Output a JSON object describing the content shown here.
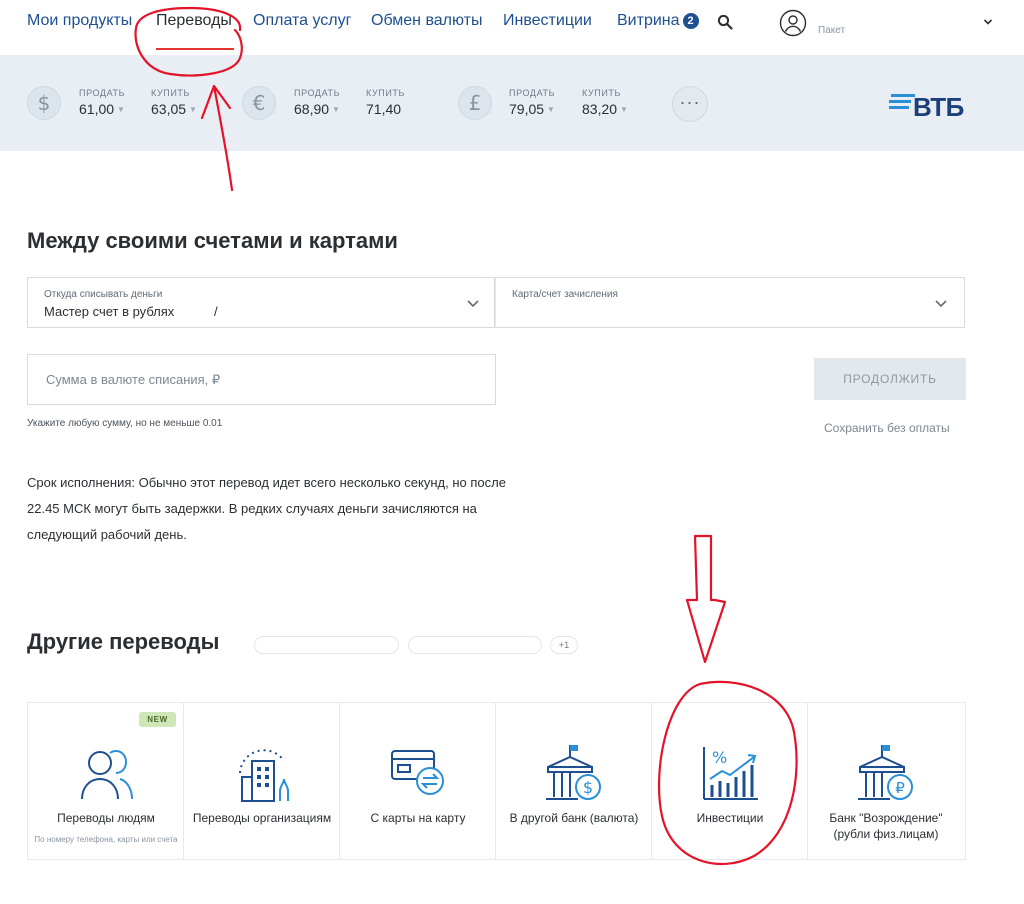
{
  "nav": {
    "items": [
      "Мои продукты",
      "Переводы",
      "Оплата услуг",
      "Обмен валюты",
      "Инвестиции",
      "Витрина"
    ],
    "showcase_badge": "2",
    "account_label": "Пакет"
  },
  "rates": {
    "sell_label": "ПРОДАТЬ",
    "buy_label": "КУПИТЬ",
    "currencies": [
      {
        "symbol": "$",
        "sell": "61,00",
        "buy": "63,05"
      },
      {
        "symbol": "€",
        "sell": "68,90",
        "buy": "71,40"
      },
      {
        "symbol": "£",
        "sell": "79,05",
        "buy": "83,20"
      }
    ],
    "more": "···",
    "logo": "ВТБ"
  },
  "transfer": {
    "title": "Между своими счетами и картами",
    "from_caption": "Откуда списывать деньги",
    "from_value": "Мастер счет в рублях           /",
    "to_caption": "Карта/счет зачисления",
    "amount_placeholder": "Сумма в валюте списания, ₽",
    "hint": "Укажите любую сумму, но не меньше 0.01",
    "continue_label": "ПРОДОЛЖИТЬ",
    "save_label": "Сохранить без оплаты",
    "note": "Срок исполнения: Обычно этот перевод идет всего несколько секунд, но после 22.45 МСК могут быть задержки. В редких случаях деньги зачисляются на следующий рабочий день."
  },
  "other": {
    "title": "Другие переводы",
    "more_pill": "+1",
    "tiles": [
      {
        "label": "Переводы людям",
        "sub": "По номеру телефона, карты или счета",
        "badge": "NEW"
      },
      {
        "label": "Переводы организациям"
      },
      {
        "label": "С карты на карту"
      },
      {
        "label": "В другой банк (валюта)"
      },
      {
        "label": "Инвестиции"
      },
      {
        "label": "Банк \"Возрождение\" (рубли физ.лицам)"
      }
    ]
  },
  "colors": {
    "nav_link": "#1d4f91",
    "rates_bg": "#e8eef3",
    "icon_blue": "#1d4f91",
    "icon_accent": "#2a8fd6",
    "annotation": "#e3142a"
  },
  "icons": [
    "search-icon",
    "user-icon",
    "chevron-down-icon",
    "people-icon",
    "building-icon",
    "cards-exchange-icon",
    "bank-dollar-icon",
    "chart-growth-icon",
    "bank-ruble-icon"
  ]
}
